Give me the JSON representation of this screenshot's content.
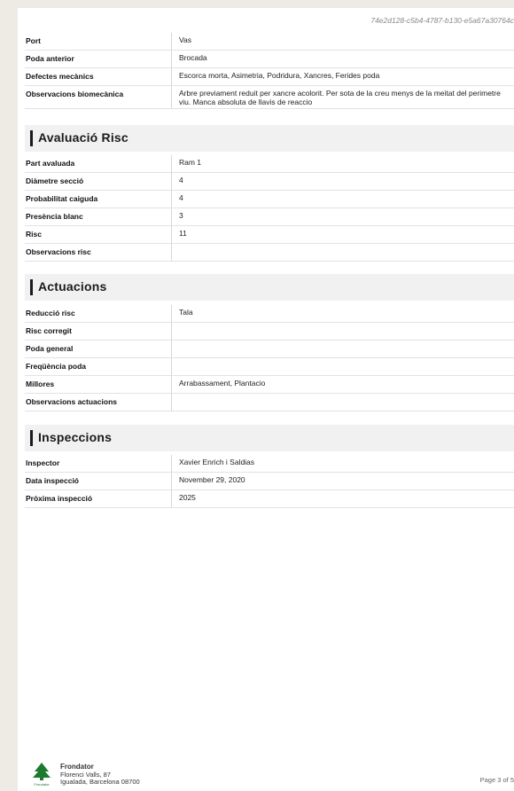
{
  "doc_id": "74e2d128-c5b4-4787-b130-e5a67a30764c",
  "top_rows": [
    {
      "label": "Port",
      "value": "Vas"
    },
    {
      "label": "Poda anterior",
      "value": "Brocada"
    },
    {
      "label": "Defectes mecànics",
      "value": "Escorca morta, Asimetria, Podridura, Xancres, Ferides poda"
    },
    {
      "label": "Observacions biomecànica",
      "value": "Arbre previament reduit per xancre acolorit. Per sota de la creu menys de la meitat del perimetre viu. Manca absoluta de llavis de reaccio"
    }
  ],
  "sections": [
    {
      "title": "Avaluació Risc",
      "rows": [
        {
          "label": "Part avaluada",
          "value": "Ram 1"
        },
        {
          "label": "Diàmetre secció",
          "value": "4"
        },
        {
          "label": "Probabilitat caiguda",
          "value": "4"
        },
        {
          "label": "Presència blanc",
          "value": "3"
        },
        {
          "label": "Risc",
          "value": "11"
        },
        {
          "label": "Observacions risc",
          "value": ""
        }
      ]
    },
    {
      "title": "Actuacions",
      "rows": [
        {
          "label": "Reducció risc",
          "value": "Tala"
        },
        {
          "label": "Risc corregit",
          "value": ""
        },
        {
          "label": "Poda general",
          "value": ""
        },
        {
          "label": "Freqüència poda",
          "value": ""
        },
        {
          "label": "Millores",
          "value": "Arrabassament, Plantacio"
        },
        {
          "label": "Observacions actuacions",
          "value": ""
        }
      ]
    },
    {
      "title": "Inspeccions",
      "rows": [
        {
          "label": "Inspector",
          "value": "Xavier Enrich i Saldias"
        },
        {
          "label": "Data inspecció",
          "value": "November 29, 2020"
        },
        {
          "label": "Pròxima inspecció",
          "value": "2025"
        }
      ]
    }
  ],
  "footer": {
    "logo_text": "Frondator",
    "org_name": "Frondator",
    "address_line1": "Florenci Valls, 87",
    "address_line2": "Igualada, Barcelona 08700",
    "page_label": "Page 3 of 5"
  },
  "colors": {
    "page_background": "#ffffff",
    "surround": "#eeebe5",
    "section_header": "#f1f1f1",
    "logo_green": "#1f7a2f"
  }
}
